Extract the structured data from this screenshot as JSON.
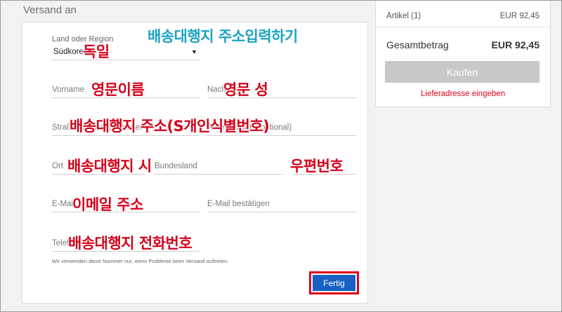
{
  "section_title": "Versand an",
  "form": {
    "country_label": "Land oder Region",
    "country_value": "Südkorea",
    "firstname_placeholder": "Vorname",
    "lastname_placeholder": "Nachname",
    "street_placeholder": "Straße und Hausnummer",
    "street2_placeholder": "Adresszusatz (optional)",
    "city_placeholder": "Ort",
    "state_placeholder": "Bundesland",
    "zip_placeholder": "",
    "email_placeholder": "E-Mail",
    "email_confirm_placeholder": "E-Mail bestätigen",
    "phone_placeholder": "Telefon",
    "phone_hint": "Wir verwenden diese Nummer nur, wenn Probleme beim Versand auftreten.",
    "submit_label": "Fertig"
  },
  "annotations": {
    "header": "배송대행지 주소입력하기",
    "country": "독일",
    "firstname": "영문이름",
    "lastname": "영문 성",
    "street": "배송대행지 주소(S개인식별번호)",
    "city": "배송대행지 시",
    "zip": "우편번호",
    "email": "이메일 주소",
    "phone": "배송대행지 전화번호"
  },
  "summary": {
    "items_label": "Artikel (1)",
    "items_price": "EUR 92,45",
    "total_label": "Gesamtbetrag",
    "total_price": "EUR 92,45",
    "buy_label": "Kaufen",
    "address_link": "Lieferadresse eingeben"
  },
  "colors": {
    "primary_button": "#1761c4",
    "highlight": "#e0001b",
    "annotation_red": "#d4001a",
    "annotation_teal": "#1aa3c2",
    "disabled_button": "#c8c8c8"
  }
}
